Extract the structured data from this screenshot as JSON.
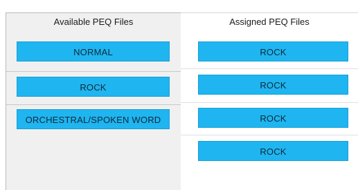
{
  "available": {
    "header": "Available PEQ Files",
    "items": [
      {
        "label": "NORMAL"
      },
      {
        "label": "ROCK"
      },
      {
        "label": "ORCHESTRAL/SPOKEN WORD"
      }
    ]
  },
  "assigned": {
    "header": "Assigned PEQ Files",
    "items": [
      {
        "label": "ROCK"
      },
      {
        "label": "ROCK"
      },
      {
        "label": "ROCK"
      },
      {
        "label": "ROCK"
      }
    ]
  },
  "colors": {
    "button_fill": "#1fb5f0",
    "left_panel_bg": "#f0f0f0",
    "right_panel_bg": "#ffffff"
  }
}
